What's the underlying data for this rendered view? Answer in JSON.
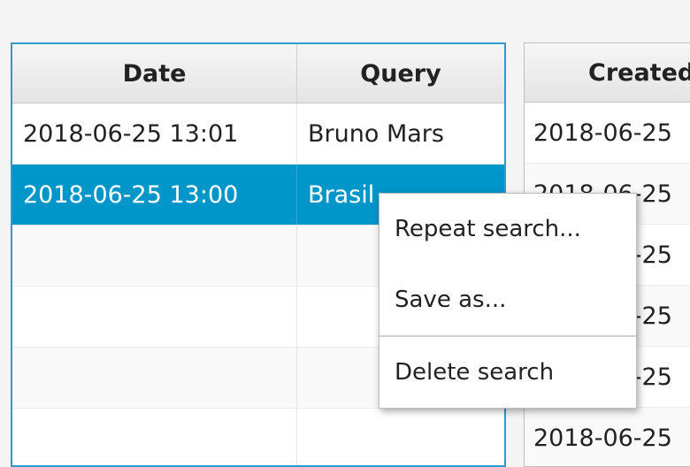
{
  "left_table": {
    "headers": {
      "date": "Date",
      "query": "Query"
    },
    "rows": [
      {
        "date": "2018-06-25 13:01",
        "query": "Bruno Mars"
      },
      {
        "date": "2018-06-25 13:00",
        "query": "Brasil"
      },
      {
        "date": "",
        "query": ""
      },
      {
        "date": "",
        "query": ""
      },
      {
        "date": "",
        "query": ""
      },
      {
        "date": "",
        "query": ""
      }
    ]
  },
  "right_table": {
    "header": "Created",
    "rows": [
      "2018-06-25",
      "2018-06-25",
      "2018-06-25",
      "2018-06-25",
      "2018-06-25",
      "2018-06-25"
    ]
  },
  "context_menu": {
    "items": [
      "Repeat search...",
      "Save as...",
      "Delete search"
    ]
  },
  "colors": {
    "selection": "#0096c9",
    "focus_border": "#2c9bd0"
  }
}
